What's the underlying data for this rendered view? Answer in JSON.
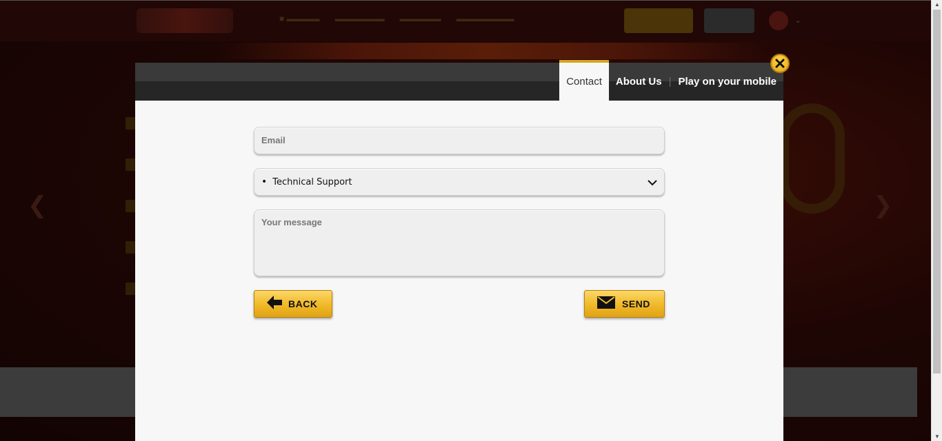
{
  "background_page": {
    "arrow_left": "❮",
    "arrow_right": "❯",
    "dropdown_caret": "⌄"
  },
  "modal": {
    "tabs": [
      {
        "label": "Contact",
        "active": true
      },
      {
        "label": "About Us",
        "active": false
      },
      {
        "label": "Play on your mobile",
        "active": false
      }
    ],
    "tab_separator": "|",
    "close_icon": "close-icon",
    "form": {
      "email_placeholder": "Email",
      "topic_bullet": "•",
      "topic_selected": "Technical Support",
      "message_placeholder": "Your message",
      "back_label": "BACK",
      "send_label": "SEND"
    }
  },
  "colors": {
    "accent_gold": "#f1bb2c",
    "modal_header": "#262626",
    "modal_body": "#f7f7f7"
  }
}
